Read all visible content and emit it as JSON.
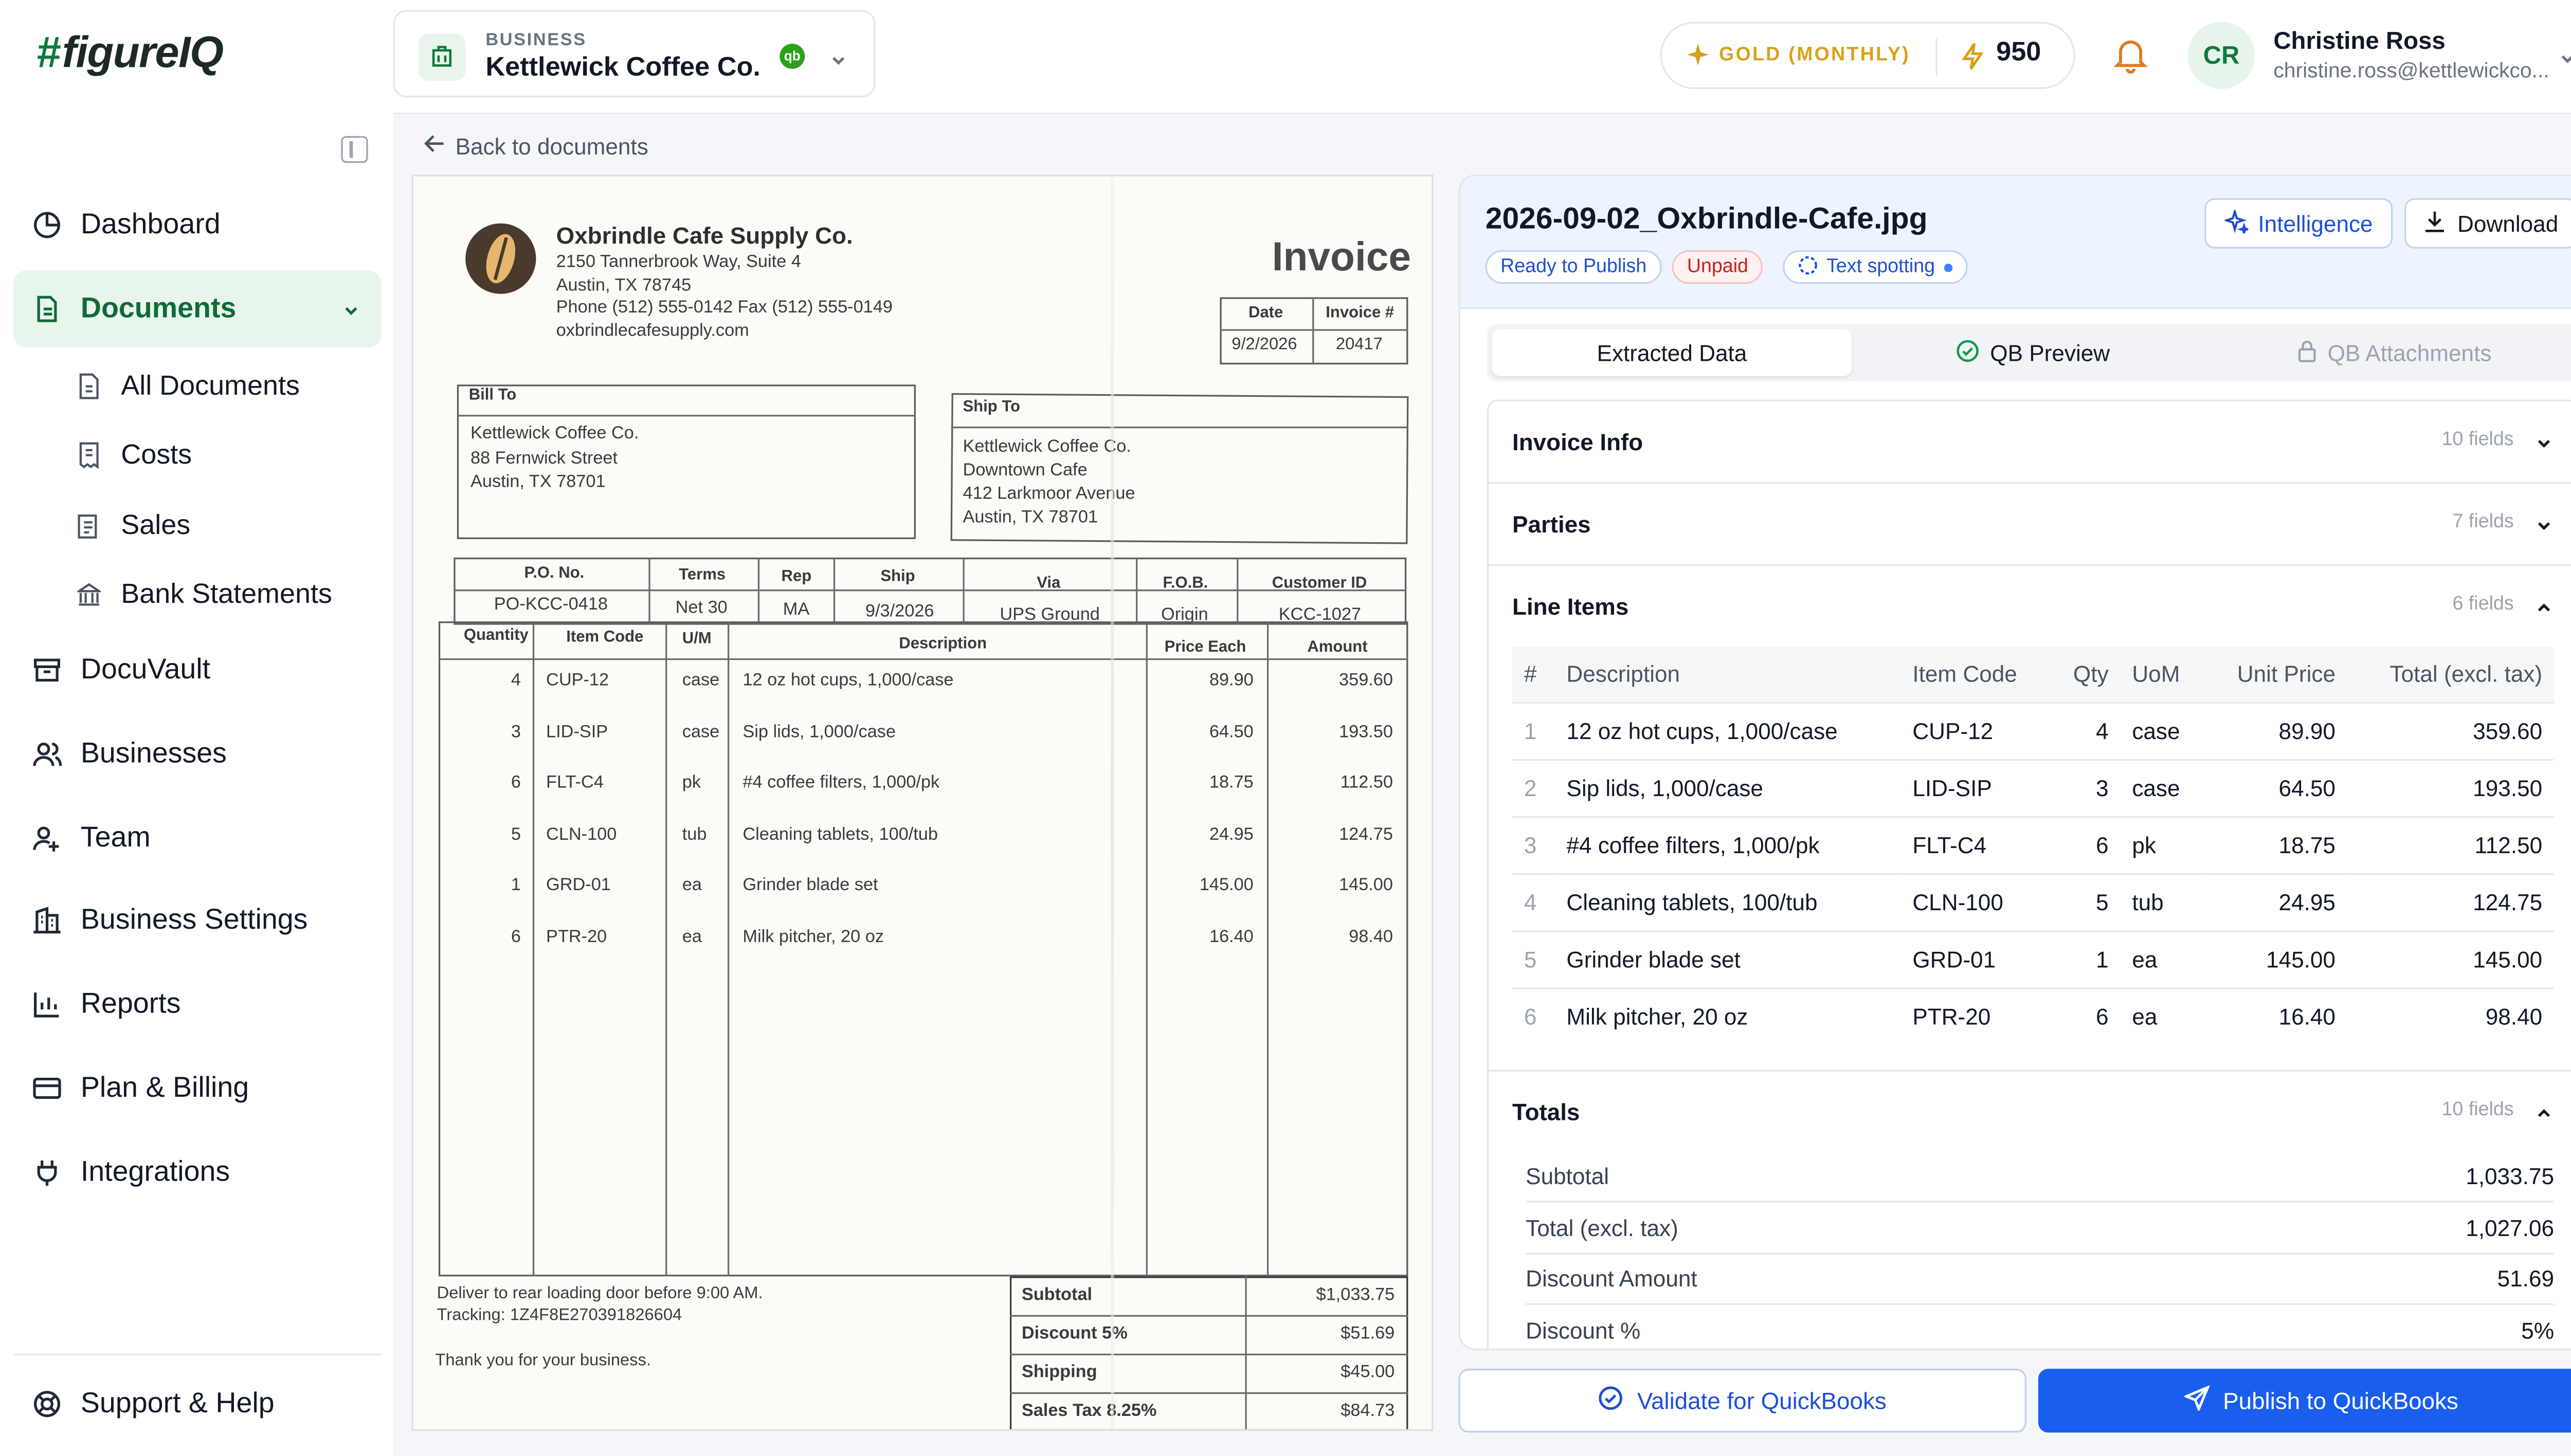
{
  "brand": {
    "hash": "#",
    "name": "figureIQ"
  },
  "sidebar": {
    "items": [
      {
        "label": "Dashboard",
        "icon": "pie-chart-icon"
      },
      {
        "label": "Documents",
        "icon": "document-icon"
      },
      {
        "label": "DocuVault",
        "icon": "archive-icon"
      },
      {
        "label": "Businesses",
        "icon": "users-icon"
      },
      {
        "label": "Team",
        "icon": "team-icon"
      },
      {
        "label": "Business Settings",
        "icon": "building-icon"
      },
      {
        "label": "Reports",
        "icon": "bar-chart-icon"
      },
      {
        "label": "Plan & Billing",
        "icon": "credit-card-icon"
      },
      {
        "label": "Integrations",
        "icon": "plug-icon"
      }
    ],
    "sub_items": [
      {
        "label": "All Documents"
      },
      {
        "label": "Costs"
      },
      {
        "label": "Sales"
      },
      {
        "label": "Bank Statements"
      }
    ],
    "support": "Support & Help"
  },
  "header": {
    "business_kicker": "BUSINESS",
    "business_name": "Kettlewick Coffee Co.",
    "qb_badge": "qb",
    "plan": "GOLD (MONTHLY)",
    "credits": "950",
    "user_initials": "CR",
    "user_name": "Christine Ross",
    "user_email": "christine.ross@kettlewickco..."
  },
  "back_link": "Back to documents",
  "invoice_image": {
    "vendor": "Oxbrindle Cafe Supply Co.",
    "addr1": "2150 Tannerbrook Way, Suite 4",
    "addr2": "Austin, TX 78745",
    "phone": "Phone (512) 555-0142   Fax (512) 555-0149",
    "web": "oxbrindlecafesupply.com",
    "heading": "Invoice",
    "date_label": "Date",
    "invno_label": "Invoice #",
    "date": "9/2/2026",
    "invno": "20417",
    "bill_to_label": "Bill To",
    "bill_to": [
      "Kettlewick Coffee Co.",
      "88 Fernwick Street",
      "Austin, TX 78701"
    ],
    "ship_to_label": "Ship To",
    "ship_to": [
      "Kettlewick Coffee Co.",
      "Downtown Cafe",
      "412 Larkmoor Avenue",
      "Austin, TX 78701"
    ],
    "meta_headers": [
      "P.O. No.",
      "Terms",
      "Rep",
      "Ship",
      "Via",
      "F.O.B.",
      "Customer ID"
    ],
    "meta_values": [
      "PO-KCC-0418",
      "Net 30",
      "MA",
      "9/3/2026",
      "UPS Ground",
      "Origin",
      "KCC-1027"
    ],
    "line_headers": [
      "Quantity",
      "Item Code",
      "U/M",
      "Description",
      "Price Each",
      "Amount"
    ],
    "lines": [
      [
        "4",
        "CUP-12",
        "case",
        "12 oz hot cups, 1,000/case",
        "89.90",
        "359.60"
      ],
      [
        "3",
        "LID-SIP",
        "case",
        "Sip lids, 1,000/case",
        "64.50",
        "193.50"
      ],
      [
        "6",
        "FLT-C4",
        "pk",
        "#4 coffee filters, 1,000/pk",
        "18.75",
        "112.50"
      ],
      [
        "5",
        "CLN-100",
        "tub",
        "Cleaning tablets, 100/tub",
        "24.95",
        "124.75"
      ],
      [
        "1",
        "GRD-01",
        "ea",
        "Grinder blade set",
        "145.00",
        "145.00"
      ],
      [
        "6",
        "PTR-20",
        "ea",
        "Milk pitcher, 20 oz",
        "16.40",
        "98.40"
      ]
    ],
    "note1": "Deliver to rear loading door before 9:00 AM.",
    "note2": "Tracking: 1Z4F8E270391826604",
    "thanks": "Thank you for your business.",
    "totals": [
      [
        "Subtotal",
        "$1,033.75"
      ],
      [
        "Discount 5%",
        "$51.69"
      ],
      [
        "Shipping",
        "$45.00"
      ],
      [
        "Sales Tax 8.25%",
        "$84.73"
      ]
    ]
  },
  "panel": {
    "filename": "2026-09-02_Oxbrindle-Cafe.jpg",
    "badges": {
      "ready": "Ready to Publish",
      "unpaid": "Unpaid",
      "spotting": "Text spotting"
    },
    "intelligence": "Intelligence",
    "download": "Download",
    "tabs": {
      "extracted": "Extracted Data",
      "preview": "QB Preview",
      "attachments": "QB Attachments"
    },
    "sections": {
      "invoice_info": {
        "title": "Invoice Info",
        "count": "10 fields"
      },
      "parties": {
        "title": "Parties",
        "count": "7 fields"
      },
      "line_items": {
        "title": "Line Items",
        "count": "6 fields"
      },
      "totals": {
        "title": "Totals",
        "count": "10 fields"
      }
    },
    "line_headers": [
      "#",
      "Description",
      "Item Code",
      "Qty",
      "UoM",
      "Unit Price",
      "Total (excl. tax)"
    ],
    "line_items": [
      [
        "1",
        "12 oz hot cups, 1,000/case",
        "CUP-12",
        "4",
        "case",
        "89.90",
        "359.60"
      ],
      [
        "2",
        "Sip lids, 1,000/case",
        "LID-SIP",
        "3",
        "case",
        "64.50",
        "193.50"
      ],
      [
        "3",
        "#4 coffee filters, 1,000/pk",
        "FLT-C4",
        "6",
        "pk",
        "18.75",
        "112.50"
      ],
      [
        "4",
        "Cleaning tablets, 100/tub",
        "CLN-100",
        "5",
        "tub",
        "24.95",
        "124.75"
      ],
      [
        "5",
        "Grinder blade set",
        "GRD-01",
        "1",
        "ea",
        "145.00",
        "145.00"
      ],
      [
        "6",
        "Milk pitcher, 20 oz",
        "PTR-20",
        "6",
        "ea",
        "16.40",
        "98.40"
      ]
    ],
    "totals": [
      [
        "Subtotal",
        "1,033.75"
      ],
      [
        "Total (excl. tax)",
        "1,027.06"
      ],
      [
        "Discount Amount",
        "51.69"
      ],
      [
        "Discount %",
        "5%"
      ]
    ]
  },
  "actions": {
    "validate": "Validate for QuickBooks",
    "publish": "Publish to QuickBooks"
  },
  "colors": {
    "brand_green": "#0f7a3c",
    "accent_blue": "#1a5ef0",
    "gold": "#d8a11a"
  }
}
